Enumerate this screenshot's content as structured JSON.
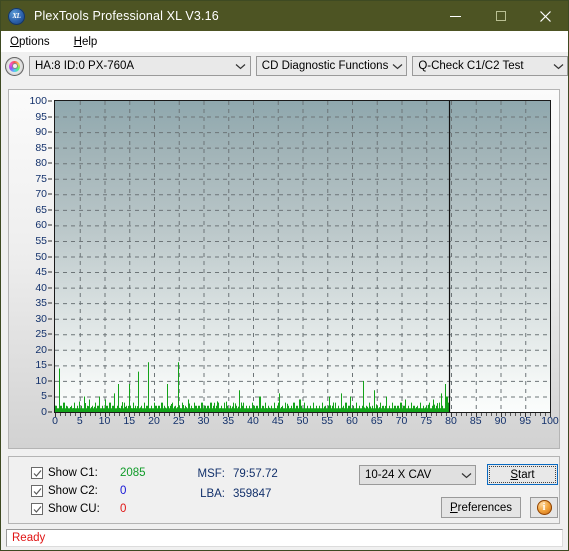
{
  "window": {
    "title": "PlexTools Professional XL V3.16",
    "app_icon": "disc-xl-icon",
    "titlebar_color": "#4d5423",
    "minimize_label": "Minimize",
    "maximize_label": "Maximize",
    "close_label": "Close"
  },
  "menubar": {
    "items": [
      {
        "label": "Options",
        "accel": "O"
      },
      {
        "label": "Help",
        "accel": "H"
      }
    ]
  },
  "toolbar": {
    "drive_combo": {
      "value": "HA:8 ID:0  PX-760A"
    },
    "function_combo": {
      "value": "CD Diagnostic Functions"
    },
    "test_combo": {
      "value": "Q-Check C1/C2 Test"
    }
  },
  "controls": {
    "legend": [
      {
        "name": "show-c1",
        "label": "Show C1:",
        "checked": true,
        "value": "2085",
        "color": "#0f9b28"
      },
      {
        "name": "show-c2",
        "label": "Show C2:",
        "checked": true,
        "value": "0",
        "color": "#1414d6"
      },
      {
        "name": "show-cu",
        "label": "Show CU:",
        "checked": true,
        "value": "0",
        "color": "#e01414"
      }
    ],
    "readouts": [
      {
        "key": "MSF:",
        "value": "79:57.72"
      },
      {
        "key": "LBA:",
        "value": "359847"
      }
    ],
    "speed_combo": {
      "value": "10-24 X CAV"
    },
    "start_button": "Start",
    "preferences_button": "Preferences",
    "info_button": "i"
  },
  "statusbar": {
    "text": "Ready",
    "color": "#e01414"
  },
  "chart_data": {
    "type": "bar",
    "title": "",
    "xlabel": "",
    "ylabel": "",
    "xlim": [
      0,
      100
    ],
    "ylim": [
      0,
      100
    ],
    "xticks": [
      0,
      5,
      10,
      15,
      20,
      25,
      30,
      35,
      40,
      45,
      50,
      55,
      60,
      65,
      70,
      75,
      80,
      85,
      90,
      95,
      100
    ],
    "yticks": [
      0,
      5,
      10,
      15,
      20,
      25,
      30,
      35,
      40,
      45,
      50,
      55,
      60,
      65,
      70,
      75,
      80,
      85,
      90,
      95,
      100
    ],
    "grid": true,
    "legend_position": "bottom-left-panel",
    "series_color": "#13a319",
    "data_end_marker_x": 79.6,
    "annotations": [
      "vertical black end-of-disc marker at x = 79.6"
    ],
    "series": [
      {
        "name": "C1",
        "color": "#13a319",
        "x": [
          0.2,
          0.5,
          0.8,
          1.1,
          1.4,
          1.7,
          2.0,
          2.3,
          2.6,
          2.9,
          3.2,
          3.5,
          3.8,
          4.1,
          4.4,
          4.7,
          5.0,
          5.3,
          5.6,
          5.9,
          6.2,
          6.5,
          6.8,
          7.1,
          7.4,
          7.7,
          8.0,
          8.3,
          8.6,
          8.9,
          9.2,
          9.5,
          9.8,
          10.1,
          10.4,
          10.7,
          11.0,
          11.3,
          11.6,
          11.9,
          12.2,
          12.5,
          12.8,
          13.1,
          13.4,
          13.7,
          14.0,
          14.3,
          14.6,
          14.9,
          15.2,
          15.5,
          15.8,
          16.1,
          16.4,
          16.7,
          17.0,
          17.3,
          17.6,
          17.9,
          18.2,
          18.5,
          18.8,
          19.1,
          19.4,
          19.7,
          20.0,
          20.3,
          20.6,
          20.9,
          21.2,
          21.5,
          21.8,
          22.1,
          22.4,
          22.7,
          23.0,
          23.3,
          23.6,
          23.9,
          24.2,
          24.5,
          24.8,
          25.1,
          25.4,
          25.7,
          26.0,
          26.3,
          26.6,
          26.9,
          27.2,
          27.5,
          27.8,
          28.1,
          28.4,
          28.7,
          29.0,
          29.3,
          29.6,
          29.9,
          30.2,
          30.5,
          30.8,
          31.1,
          31.4,
          31.7,
          32.0,
          32.3,
          32.6,
          32.9,
          33.2,
          33.5,
          33.8,
          34.1,
          34.4,
          34.7,
          35.0,
          35.3,
          35.6,
          35.9,
          36.2,
          36.5,
          36.8,
          37.1,
          37.4,
          37.7,
          38.0,
          38.3,
          38.6,
          38.9,
          39.2,
          39.5,
          39.8,
          40.1,
          40.4,
          40.7,
          41.0,
          41.3,
          41.6,
          41.9,
          42.2,
          42.5,
          42.8,
          43.1,
          43.4,
          43.7,
          44.0,
          44.3,
          44.6,
          44.9,
          45.2,
          45.5,
          45.8,
          46.1,
          46.4,
          46.7,
          47.0,
          47.3,
          47.6,
          47.9,
          48.2,
          48.5,
          48.8,
          49.1,
          49.4,
          49.7,
          50.0,
          50.3,
          50.6,
          50.9,
          51.2,
          51.5,
          51.8,
          52.1,
          52.4,
          52.7,
          53.0,
          53.3,
          53.6,
          53.9,
          54.2,
          54.5,
          54.8,
          55.1,
          55.4,
          55.7,
          56.0,
          56.3,
          56.6,
          56.9,
          57.2,
          57.5,
          57.8,
          58.1,
          58.4,
          58.7,
          59.0,
          59.3,
          59.6,
          59.9,
          60.2,
          60.5,
          60.8,
          61.1,
          61.4,
          61.7,
          62.0,
          62.3,
          62.6,
          62.9,
          63.2,
          63.5,
          63.8,
          64.1,
          64.4,
          64.7,
          65.0,
          65.3,
          65.6,
          65.9,
          66.2,
          66.5,
          66.8,
          67.1,
          67.4,
          67.7,
          68.0,
          68.3,
          68.6,
          68.9,
          69.2,
          69.5,
          69.8,
          70.1,
          70.4,
          70.7,
          71.0,
          71.3,
          71.6,
          71.9,
          72.2,
          72.5,
          72.8,
          73.1,
          73.4,
          73.7,
          74.0,
          74.3,
          74.6,
          74.9,
          75.2,
          75.5,
          75.8,
          76.1,
          76.4,
          76.7,
          77.0,
          77.3,
          77.6,
          77.9,
          78.2,
          78.5,
          78.8,
          79.1,
          79.4
        ],
        "values": [
          2,
          1,
          14,
          2,
          1,
          3,
          1,
          2,
          1,
          1,
          2,
          1,
          3,
          1,
          2,
          1,
          1,
          2,
          1,
          5,
          1,
          2,
          4,
          1,
          2,
          1,
          3,
          1,
          2,
          5,
          1,
          2,
          1,
          4,
          2,
          1,
          3,
          1,
          2,
          6,
          1,
          2,
          9,
          1,
          2,
          1,
          3,
          2,
          1,
          9,
          2,
          1,
          3,
          2,
          1,
          13,
          1,
          2,
          1,
          3,
          1,
          2,
          16,
          1,
          2,
          1,
          3,
          2,
          1,
          2,
          1,
          3,
          1,
          2,
          1,
          9,
          1,
          2,
          3,
          1,
          2,
          1,
          16,
          2,
          1,
          3,
          1,
          2,
          1,
          4,
          1,
          2,
          1,
          3,
          2,
          1,
          2,
          1,
          3,
          1,
          2,
          1,
          2,
          1,
          3,
          1,
          2,
          1,
          2,
          3,
          1,
          2,
          1,
          3,
          1,
          2,
          1,
          2,
          1,
          3,
          1,
          2,
          1,
          7,
          1,
          2,
          3,
          1,
          2,
          1,
          2,
          1,
          3,
          2,
          1,
          2,
          1,
          5,
          1,
          2,
          1,
          3,
          1,
          2,
          1,
          2,
          1,
          3,
          1,
          2,
          6,
          1,
          2,
          1,
          3,
          1,
          2,
          1,
          2,
          1,
          3,
          1,
          2,
          1,
          4,
          2,
          1,
          3,
          1,
          2,
          1,
          2,
          1,
          3,
          1,
          2,
          1,
          2,
          1,
          3,
          1,
          2,
          1,
          2,
          5,
          1,
          2,
          1,
          3,
          1,
          2,
          1,
          6,
          2,
          1,
          3,
          1,
          2,
          5,
          1,
          2,
          1,
          3,
          1,
          2,
          1,
          2,
          10,
          1,
          2,
          1,
          3,
          1,
          2,
          7,
          1,
          2,
          1,
          3,
          1,
          2,
          1,
          5,
          1,
          2,
          1,
          3,
          1,
          2,
          1,
          2,
          1,
          3,
          1,
          2,
          4,
          1,
          2,
          1,
          3,
          1,
          2,
          1,
          2,
          1,
          3,
          1,
          2,
          1,
          2,
          1,
          3,
          1,
          2,
          4,
          1,
          2,
          1,
          3,
          6,
          2,
          1,
          9,
          5,
          3,
          2,
          1
        ]
      }
    ]
  }
}
